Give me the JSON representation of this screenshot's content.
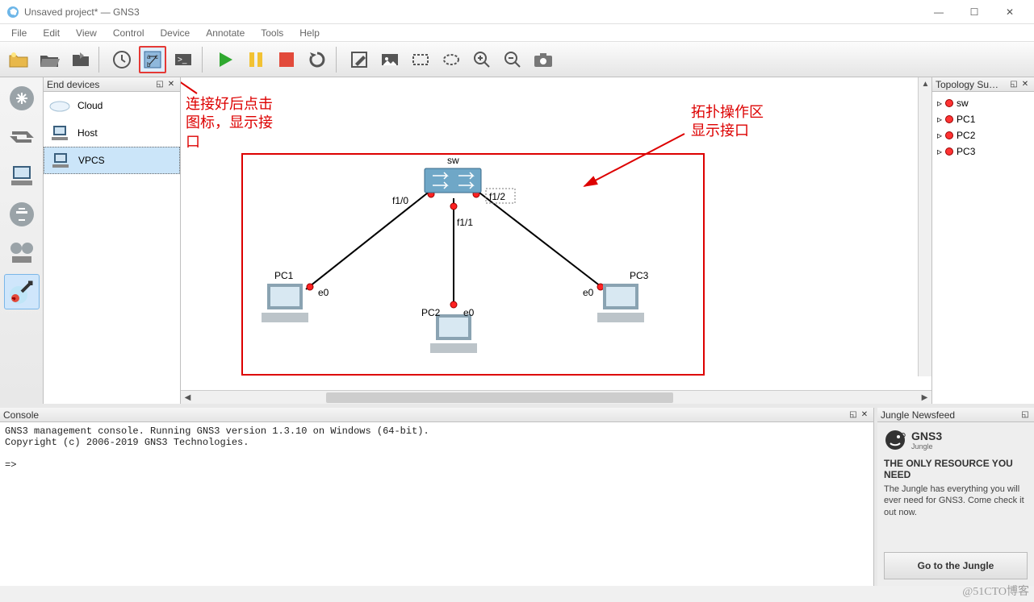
{
  "window": {
    "title": "Unsaved project* — GNS3"
  },
  "menu": [
    "File",
    "Edit",
    "View",
    "Control",
    "Device",
    "Annotate",
    "Tools",
    "Help"
  ],
  "devices_panel": {
    "title": "End devices",
    "items": [
      {
        "name": "Cloud",
        "selected": false
      },
      {
        "name": "Host",
        "selected": false
      },
      {
        "name": "VPCS",
        "selected": true
      }
    ]
  },
  "topology_panel": {
    "title": "Topology Su…",
    "items": [
      "sw",
      "PC1",
      "PC2",
      "PC3"
    ]
  },
  "topology": {
    "nodes": {
      "sw": {
        "label": "sw"
      },
      "pc1": {
        "label": "PC1"
      },
      "pc2": {
        "label": "PC2"
      },
      "pc3": {
        "label": "PC3"
      }
    },
    "links": [
      {
        "from": "sw",
        "port_from": "f1/0",
        "to": "pc1",
        "port_to": "e0"
      },
      {
        "from": "sw",
        "port_from": "f1/1",
        "to": "pc2",
        "port_to": "e0"
      },
      {
        "from": "sw",
        "port_from": "f1/2",
        "to": "pc3",
        "port_to": "e0"
      }
    ]
  },
  "annotations": {
    "a1": "连接好后点击\n图标，显示接\n口",
    "a2": "拓扑操作区\n显示接口"
  },
  "console": {
    "title": "Console",
    "text": "GNS3 management console. Running GNS3 version 1.3.10 on Windows (64-bit).\nCopyright (c) 2006-2019 GNS3 Technologies.\n\n=>"
  },
  "newsfeed": {
    "title": "Jungle Newsfeed",
    "brand_line1": "GNS3",
    "brand_line2": "Jungle",
    "headline": "THE ONLY RESOURCE YOU NEED",
    "body": "The Jungle has everything you will ever need for GNS3. Come check it out now.",
    "button": "Go to the Jungle"
  },
  "watermark": "@51CTO博客"
}
